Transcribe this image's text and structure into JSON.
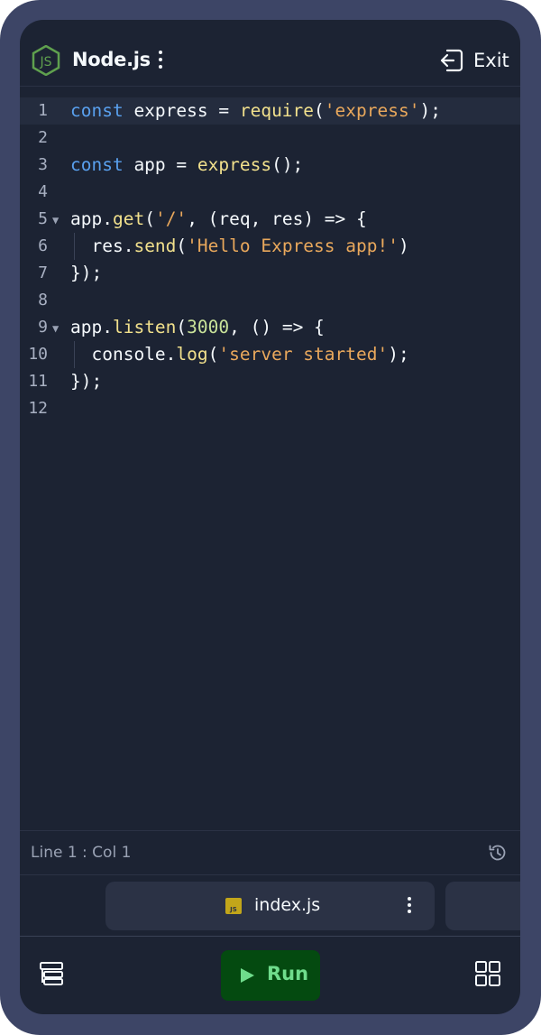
{
  "header": {
    "title": "Node.js",
    "logo_text": "JS",
    "exit_label": "Exit"
  },
  "editor": {
    "active_line": 1,
    "lines": [
      {
        "n": "1",
        "tokens": [
          [
            "kw",
            "const"
          ],
          [
            "",
            " express = "
          ],
          [
            "fn",
            "require"
          ],
          [
            "",
            "("
          ],
          [
            "str",
            "'express'"
          ],
          [
            "",
            ");"
          ]
        ]
      },
      {
        "n": "2",
        "tokens": []
      },
      {
        "n": "3",
        "tokens": [
          [
            "kw",
            "const"
          ],
          [
            "",
            " app = "
          ],
          [
            "fn",
            "express"
          ],
          [
            "",
            "();"
          ]
        ]
      },
      {
        "n": "4",
        "tokens": []
      },
      {
        "n": "5",
        "fold": true,
        "tokens": [
          [
            "",
            "app."
          ],
          [
            "fn",
            "get"
          ],
          [
            "",
            "("
          ],
          [
            "str",
            "'/'"
          ],
          [
            "",
            ", (req, res) => {"
          ]
        ]
      },
      {
        "n": "6",
        "indent": true,
        "tokens": [
          [
            "",
            "  res."
          ],
          [
            "fn",
            "send"
          ],
          [
            "",
            "("
          ],
          [
            "str",
            "'Hello Express app!'"
          ],
          [
            "",
            ")"
          ]
        ]
      },
      {
        "n": "7",
        "tokens": [
          [
            "",
            "});"
          ]
        ]
      },
      {
        "n": "8",
        "tokens": []
      },
      {
        "n": "9",
        "fold": true,
        "tokens": [
          [
            "",
            "app."
          ],
          [
            "fn",
            "listen"
          ],
          [
            "",
            "("
          ],
          [
            "num",
            "3000"
          ],
          [
            "",
            ", () => {"
          ]
        ]
      },
      {
        "n": "10",
        "indent": true,
        "tokens": [
          [
            "",
            "  console."
          ],
          [
            "fn",
            "log"
          ],
          [
            "",
            "("
          ],
          [
            "str",
            "'server started'"
          ],
          [
            "",
            ");"
          ]
        ]
      },
      {
        "n": "11",
        "tokens": [
          [
            "",
            "});"
          ]
        ]
      },
      {
        "n": "12",
        "tokens": []
      }
    ]
  },
  "status": {
    "cursor_position": "Line 1 : Col 1"
  },
  "tabs": {
    "active_file": "index.js",
    "active_file_icon": "JS"
  },
  "toolbar": {
    "run_label": "Run"
  },
  "colors": {
    "background": "#1c2333",
    "frame": "#3d4566",
    "keyword": "#59a0ee",
    "function": "#f1e08c",
    "string": "#e9a85c",
    "number": "#c9e39a",
    "run_button": "#044a10",
    "run_text": "#6fdc8c"
  },
  "icons": {
    "logo": "nodejs-hexagon-icon",
    "menu": "kebab-menu-icon",
    "exit": "exit-icon",
    "history": "history-icon",
    "file": "js-file-icon",
    "left_tool": "layers-icon",
    "run": "play-icon",
    "right_tool": "grid-icon"
  }
}
